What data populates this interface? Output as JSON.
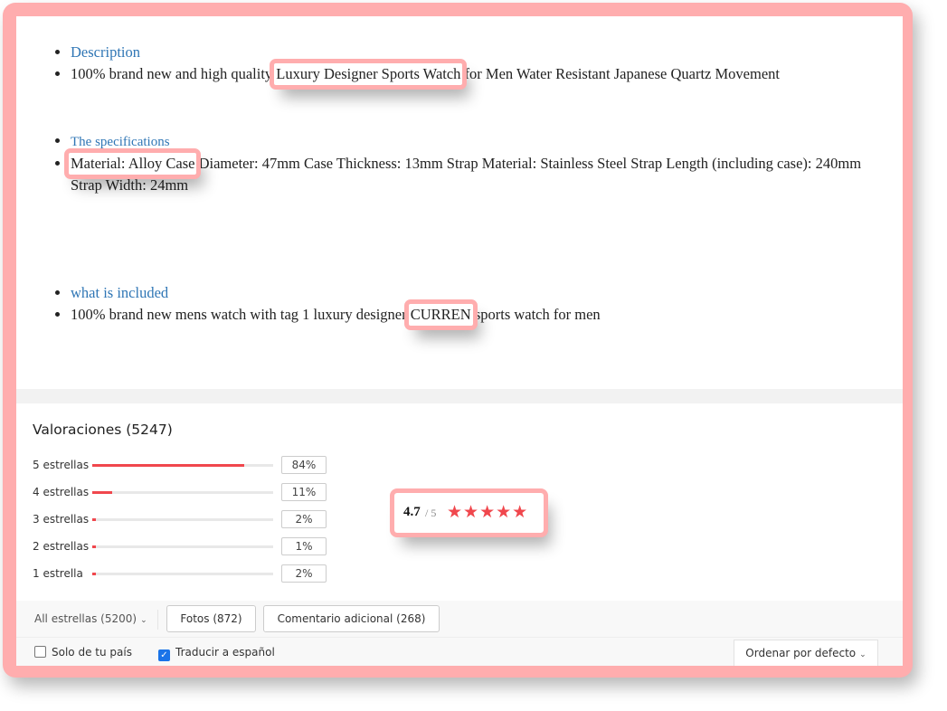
{
  "description": {
    "section1": {
      "heading": "Description",
      "text_before": "100% brand new and high quality ",
      "highlight": "Luxury Designer Sports Watch",
      "text_after": " for Men Water Resistant Japanese Quartz Movement"
    },
    "section2": {
      "heading": "The specifications",
      "highlight": "Material: Alloy Case",
      "text_after": " Diameter: 47mm Case Thickness: 13mm Strap Material: Stainless Steel Strap Length (including case): 240mm Strap Width: 24mm"
    },
    "section3": {
      "heading": "what is included",
      "text_before": "100% brand new mens watch with tag 1 luxury designer ",
      "highlight": "CURREN",
      "text_after": " sports watch for men"
    }
  },
  "ratings": {
    "title": "Valoraciones (5247)",
    "rows": [
      {
        "label": "5 estrellas",
        "percent_text": "84%",
        "percent": 84
      },
      {
        "label": "4 estrellas",
        "percent_text": "11%",
        "percent": 11
      },
      {
        "label": "3 estrellas",
        "percent_text": "2%",
        "percent": 2
      },
      {
        "label": "2 estrellas",
        "percent_text": "1%",
        "percent": 1
      },
      {
        "label": "1 estrella",
        "percent_text": "2%",
        "percent": 2
      }
    ],
    "score": "4.7",
    "score_max": "/ 5",
    "stars_icon": "★★★★★",
    "star_color": "#f0474d"
  },
  "filters": {
    "all_stars": "All estrellas (5200)",
    "photos": "Fotos (872)",
    "additional_comment": "Comentario adicional (268)",
    "only_country": "Solo de tu país",
    "only_country_checked": false,
    "translate": "Traducir a español",
    "translate_checked": true,
    "sort": "Ordenar por defecto",
    "chevron_icon": "⌄"
  }
}
